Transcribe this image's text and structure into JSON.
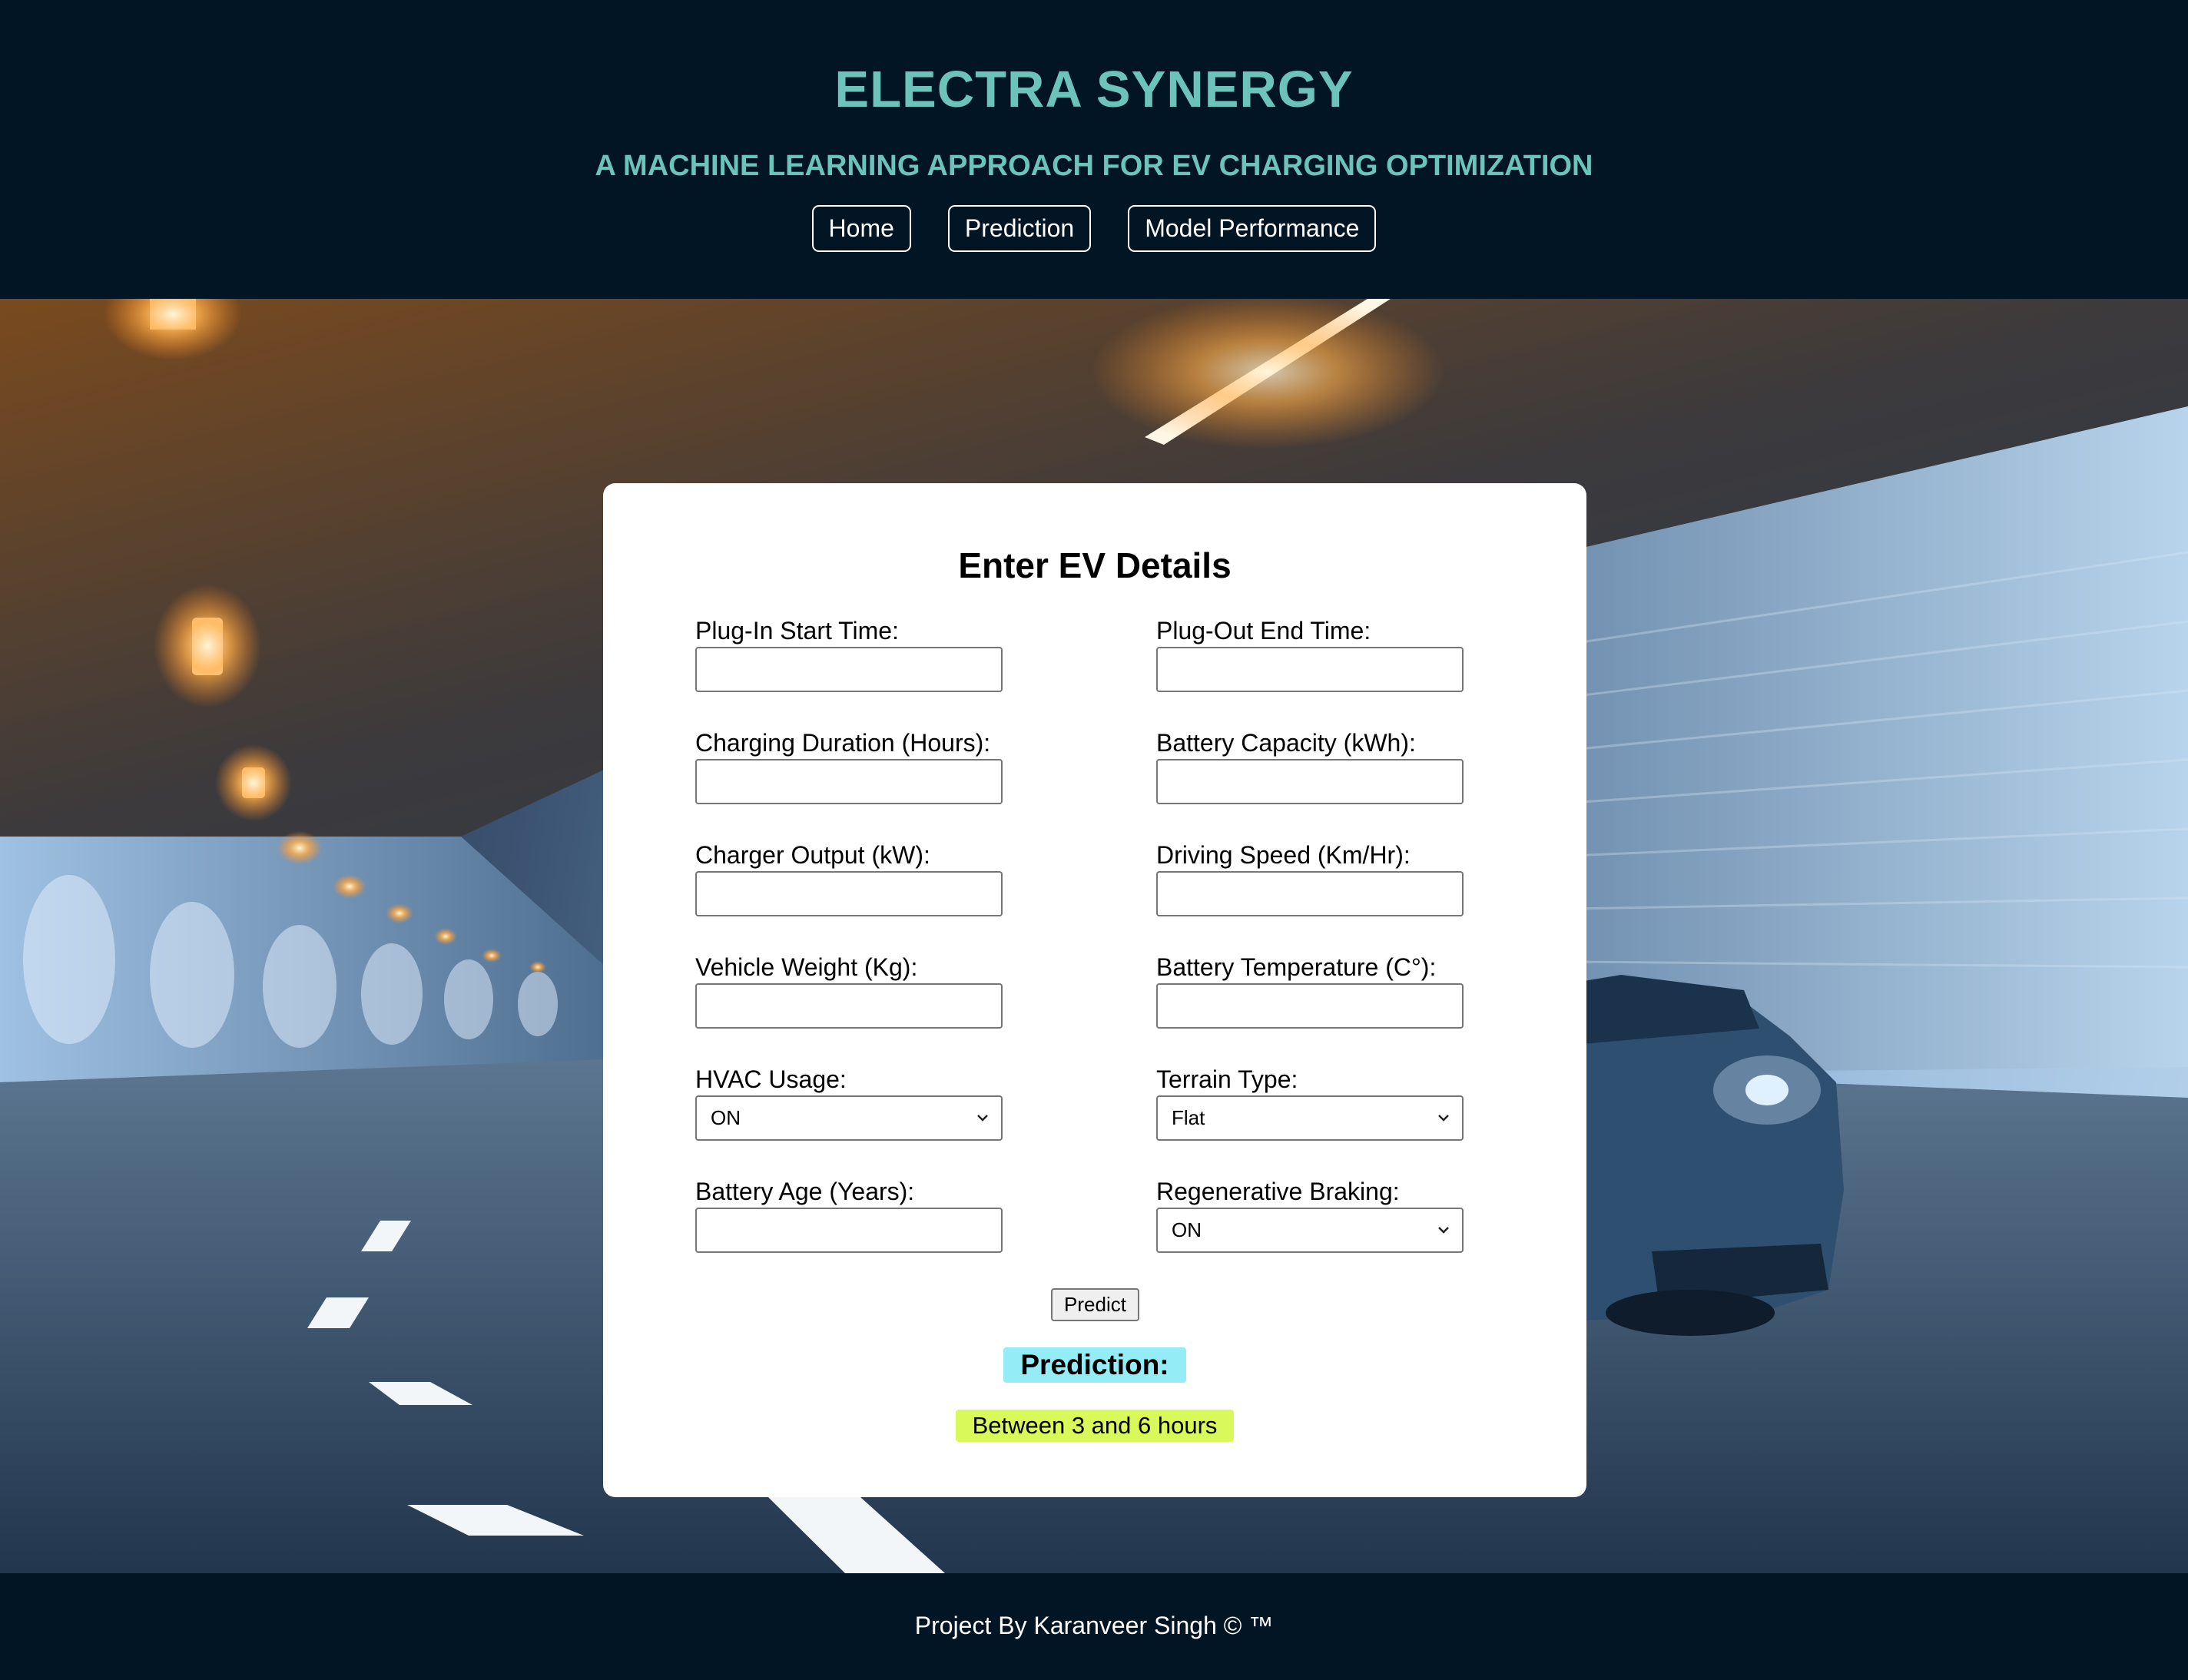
{
  "header": {
    "title": "ELECTRA SYNERGY",
    "subtitle": "A MACHINE LEARNING APPROACH FOR EV CHARGING OPTIMIZATION",
    "nav": {
      "home": "Home",
      "prediction": "Prediction",
      "model_performance": "Model Performance"
    }
  },
  "form": {
    "title": "Enter EV Details",
    "fields": {
      "plug_in_start": {
        "label": "Plug-In Start Time:",
        "value": ""
      },
      "plug_out_end": {
        "label": "Plug-Out End Time:",
        "value": ""
      },
      "charging_duration": {
        "label": "Charging Duration (Hours):",
        "value": ""
      },
      "battery_capacity": {
        "label": "Battery Capacity (kWh):",
        "value": ""
      },
      "charger_output": {
        "label": "Charger Output (kW):",
        "value": ""
      },
      "driving_speed": {
        "label": "Driving Speed (Km/Hr):",
        "value": ""
      },
      "vehicle_weight": {
        "label": "Vehicle Weight (Kg):",
        "value": ""
      },
      "battery_temperature": {
        "label": "Battery Temperature (C°):",
        "value": ""
      },
      "hvac_usage": {
        "label": "HVAC Usage:",
        "selected": "ON"
      },
      "terrain_type": {
        "label": "Terrain Type:",
        "selected": "Flat"
      },
      "battery_age": {
        "label": "Battery Age (Years):",
        "value": ""
      },
      "regenerative_braking": {
        "label": "Regenerative Braking:",
        "selected": "ON"
      }
    },
    "predict_label": "Predict",
    "prediction_heading": "Prediction:",
    "prediction_result": "Between 3 and 6 hours"
  },
  "footer": {
    "text": "Project By Karanveer Singh © ™"
  },
  "icons": {
    "select_arrow": "chevron-down-icon"
  },
  "colors": {
    "header_bg": "#021525",
    "accent_teal": "#6cc3b9",
    "prediction_heading_bg": "#94ecf7",
    "prediction_result_bg": "#d9f85a"
  }
}
